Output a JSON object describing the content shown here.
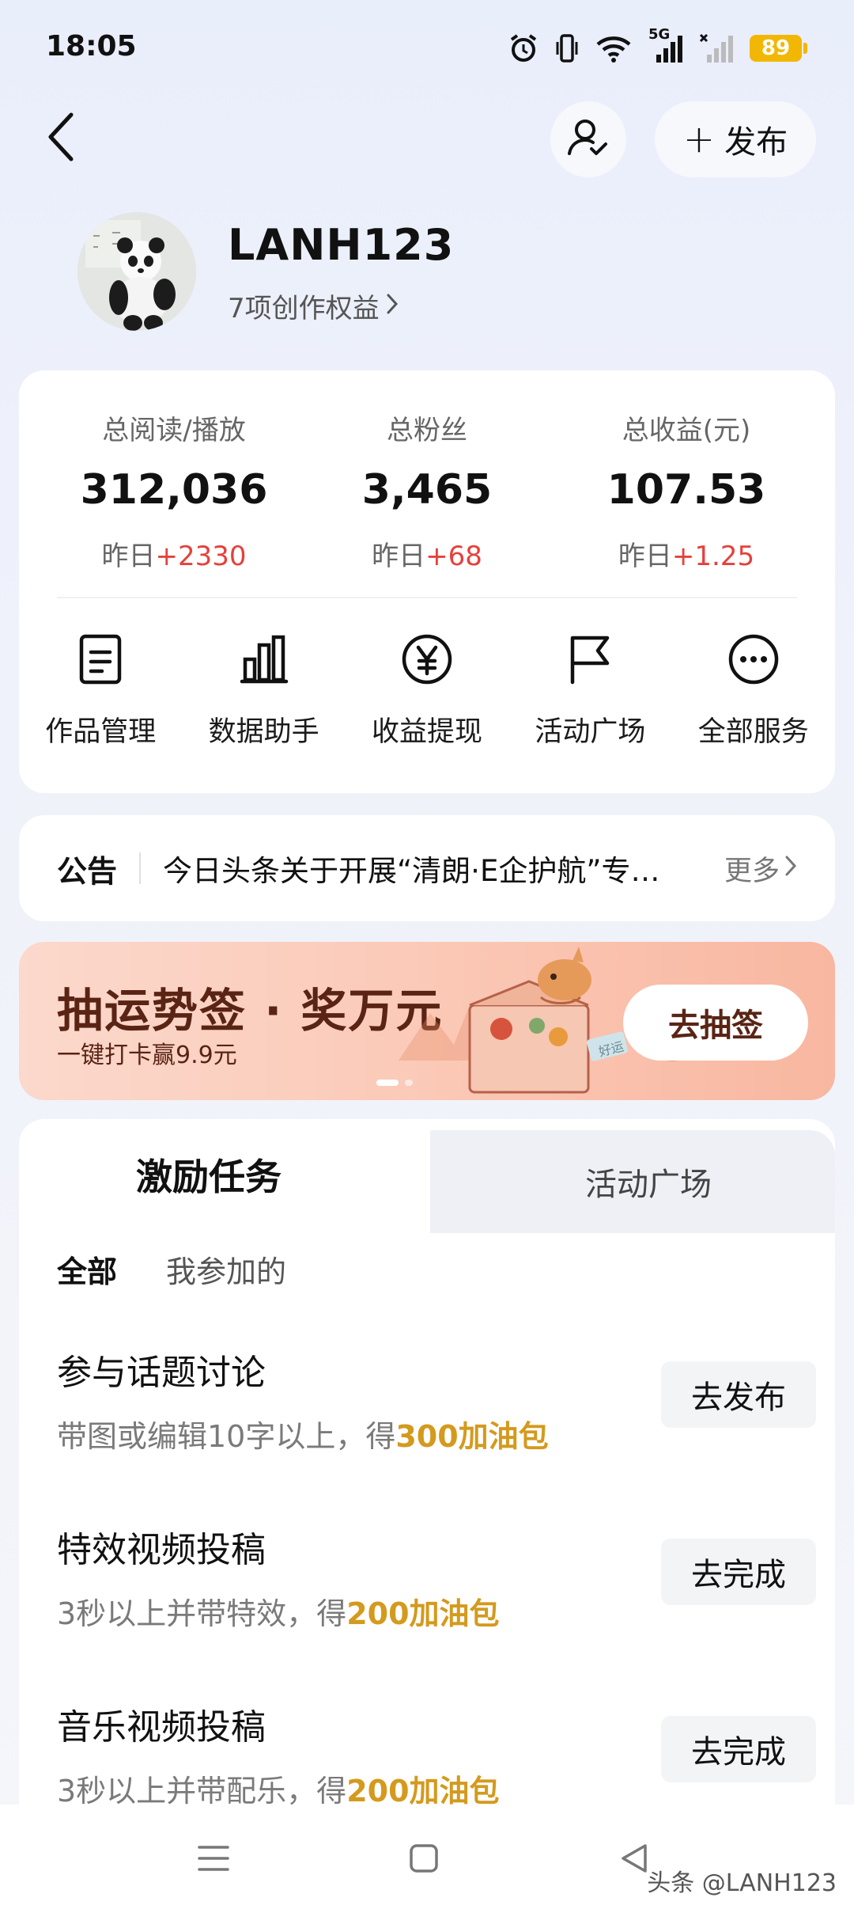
{
  "status_bar": {
    "time": "18:05",
    "network_label": "5G",
    "battery": "89",
    "icons": [
      "alarm-icon",
      "vibrate-icon",
      "wifi-icon",
      "signal-5g-icon",
      "signal-icon",
      "battery-icon"
    ]
  },
  "header": {
    "back_icon": "chevron-left-icon",
    "follow_icon": "user-check-icon",
    "publish_label": "发布",
    "publish_plus": "+"
  },
  "profile": {
    "username": "LANH123",
    "benefits": "7项创作权益"
  },
  "stats": [
    {
      "label": "总阅读/播放",
      "value": "312,036",
      "change_prefix": "昨日",
      "change": "+2330"
    },
    {
      "label": "总粉丝",
      "value": "3,465",
      "change_prefix": "昨日",
      "change": "+68"
    },
    {
      "label": "总收益(元)",
      "value": "107.53",
      "change_prefix": "昨日",
      "change": "+1.25"
    }
  ],
  "services": [
    {
      "label": "作品管理",
      "icon": "document-icon"
    },
    {
      "label": "数据助手",
      "icon": "bar-chart-icon"
    },
    {
      "label": "收益提现",
      "icon": "yen-icon"
    },
    {
      "label": "活动广场",
      "icon": "flag-icon"
    },
    {
      "label": "全部服务",
      "icon": "more-icon"
    }
  ],
  "notice": {
    "title": "公告",
    "text": "今日头条关于开展“清朗·E企护航”专项行动的公告",
    "more": "更多"
  },
  "banner": {
    "title": "抽运势签 · 奖万元",
    "subtitle": "一键打卡赢9.9元",
    "button": "去抽签",
    "art_label": "好运",
    "colors": {
      "start": "#fbd9cc",
      "end": "#f8b7a0",
      "text": "#5a2415"
    }
  },
  "tabs": {
    "active": "激励任务",
    "inactive": "活动广场"
  },
  "filters": [
    "全部",
    "我参加的"
  ],
  "tasks": [
    {
      "title": "参与话题讨论",
      "desc": "带图或编辑10字以上，得",
      "reward": "300加油包",
      "button": "去发布"
    },
    {
      "title": "特效视频投稿",
      "desc": "3秒以上并带特效，得",
      "reward": "200加油包",
      "button": "去完成"
    },
    {
      "title": "音乐视频投稿",
      "desc": "3秒以上并带配乐，得",
      "reward": "200加油包",
      "button": "去完成"
    }
  ],
  "nav": {
    "icons": [
      "menu-icon",
      "home-square-icon",
      "back-triangle-icon"
    ]
  },
  "watermark": "头条 @LANH123",
  "colors": {
    "accent_red": "#e5413b",
    "reward_gold": "#d49a1e",
    "battery": "#f2b705"
  }
}
